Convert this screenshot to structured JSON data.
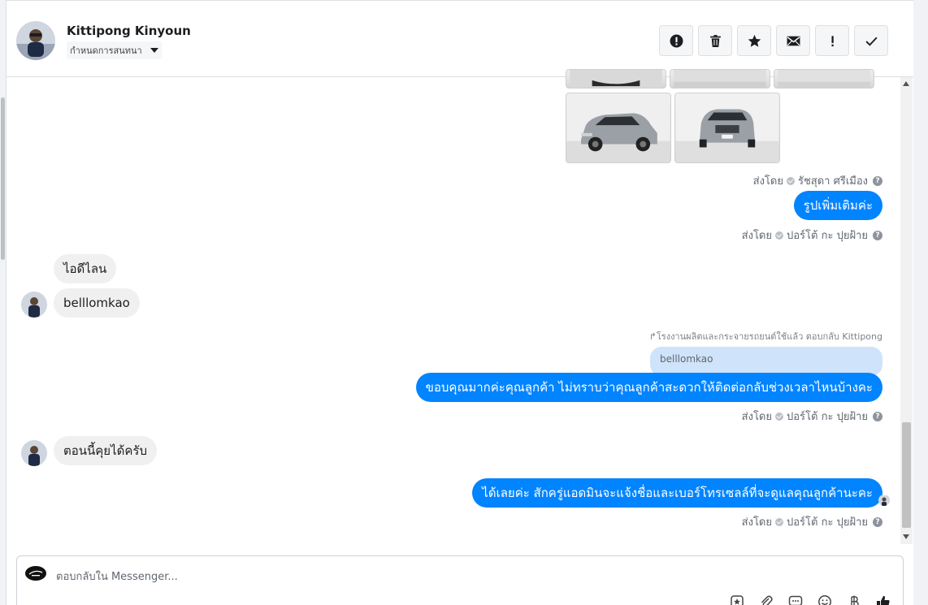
{
  "header": {
    "contact_name": "Kittipong Kinyoun",
    "conversation_settings": "กำหนดการสนทนา",
    "toolbar": [
      {
        "name": "spam-button",
        "icon": "alert-circle-icon"
      },
      {
        "name": "delete-button",
        "icon": "trash-icon"
      },
      {
        "name": "star-button",
        "icon": "star-icon"
      },
      {
        "name": "mark-unread-button",
        "icon": "envelope-icon"
      },
      {
        "name": "follow-up-button",
        "icon": "exclamation-icon"
      },
      {
        "name": "mark-done-button",
        "icon": "checkmark-icon"
      }
    ]
  },
  "thread": {
    "sent_by_1": {
      "prefix": "ส่งโดย",
      "agent": "รัชสุดา ศรีเมือง"
    },
    "msg_more_photos": "รูปเพิ่มเติมค่ะ",
    "sent_by_2": {
      "prefix": "ส่งโดย",
      "agent": "ปอร์โต้ กะ ปุยฝ้าย"
    },
    "msg_line_id_label": "ไอดีไลน",
    "msg_line_id": "belllomkao",
    "reply_meta": "โรงงานผลิตและกระจายรถยนต์ใช้แล้ว ตอบกลับ Kittipong",
    "quoted_text": "belllomkao",
    "msg_thanks": "ขอบคุณมากค่ะคุณลูกค้า ไม่ทราบว่าคุณลูกค้าสะดวกให้ติดต่อกลับช่วงเวลาไหนบ้างคะ",
    "sent_by_3": {
      "prefix": "ส่งโดย",
      "agent": "ปอร์โต้ กะ ปุยฝ้าย"
    },
    "msg_now": "ตอนนี้คุยได้ครับ",
    "msg_admin": "ได้เลยค่ะ สักครู่แอดมินจะแจ้งชื่อและเบอร์โทรเซลล์ที่จะดูแลคุณลูกค้านะคะ",
    "sent_by_4": {
      "prefix": "ส่งโดย",
      "agent": "ปอร์โต้ กะ ปุยฝ้าย"
    }
  },
  "composer": {
    "placeholder": "ตอบกลับใน Messenger...",
    "tools": [
      "saved-reply-icon",
      "attachment-icon",
      "quick-reply-icon",
      "emoji-icon",
      "baht-icon",
      "like-icon"
    ]
  },
  "colors": {
    "outgoing_bubble": "#0084ff",
    "incoming_bubble": "#f0f0f0",
    "quote_bubble": "#cfe3fb"
  }
}
